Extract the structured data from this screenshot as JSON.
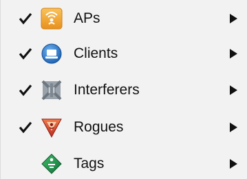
{
  "menu": {
    "items": [
      {
        "label": "APs",
        "checked": true,
        "icon": "ap-icon",
        "has_submenu": true
      },
      {
        "label": "Clients",
        "checked": true,
        "icon": "client-icon",
        "has_submenu": true
      },
      {
        "label": "Interferers",
        "checked": true,
        "icon": "interferer-icon",
        "has_submenu": true
      },
      {
        "label": "Rogues",
        "checked": true,
        "icon": "rogue-icon",
        "has_submenu": true
      },
      {
        "label": "Tags",
        "checked": false,
        "icon": "tag-icon",
        "has_submenu": true
      }
    ]
  },
  "colors": {
    "background": "#f2f2f2",
    "text": "#111111",
    "ap_orange": "#f2a22a",
    "client_blue": "#2f7fd6",
    "rogue_red": "#d9422b",
    "tag_green": "#1f8f4a"
  }
}
